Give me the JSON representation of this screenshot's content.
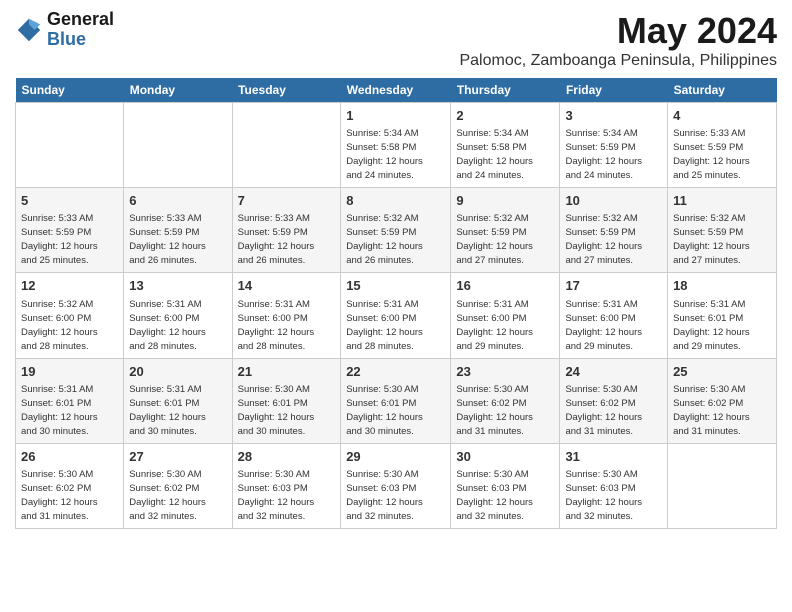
{
  "logo": {
    "general": "General",
    "blue": "Blue"
  },
  "title": {
    "month": "May 2024",
    "location": "Palomoc, Zamboanga Peninsula, Philippines"
  },
  "weekdays": [
    "Sunday",
    "Monday",
    "Tuesday",
    "Wednesday",
    "Thursday",
    "Friday",
    "Saturday"
  ],
  "weeks": [
    [
      {
        "day": "",
        "info": ""
      },
      {
        "day": "",
        "info": ""
      },
      {
        "day": "",
        "info": ""
      },
      {
        "day": "1",
        "info": "Sunrise: 5:34 AM\nSunset: 5:58 PM\nDaylight: 12 hours\nand 24 minutes."
      },
      {
        "day": "2",
        "info": "Sunrise: 5:34 AM\nSunset: 5:58 PM\nDaylight: 12 hours\nand 24 minutes."
      },
      {
        "day": "3",
        "info": "Sunrise: 5:34 AM\nSunset: 5:59 PM\nDaylight: 12 hours\nand 24 minutes."
      },
      {
        "day": "4",
        "info": "Sunrise: 5:33 AM\nSunset: 5:59 PM\nDaylight: 12 hours\nand 25 minutes."
      }
    ],
    [
      {
        "day": "5",
        "info": "Sunrise: 5:33 AM\nSunset: 5:59 PM\nDaylight: 12 hours\nand 25 minutes."
      },
      {
        "day": "6",
        "info": "Sunrise: 5:33 AM\nSunset: 5:59 PM\nDaylight: 12 hours\nand 26 minutes."
      },
      {
        "day": "7",
        "info": "Sunrise: 5:33 AM\nSunset: 5:59 PM\nDaylight: 12 hours\nand 26 minutes."
      },
      {
        "day": "8",
        "info": "Sunrise: 5:32 AM\nSunset: 5:59 PM\nDaylight: 12 hours\nand 26 minutes."
      },
      {
        "day": "9",
        "info": "Sunrise: 5:32 AM\nSunset: 5:59 PM\nDaylight: 12 hours\nand 27 minutes."
      },
      {
        "day": "10",
        "info": "Sunrise: 5:32 AM\nSunset: 5:59 PM\nDaylight: 12 hours\nand 27 minutes."
      },
      {
        "day": "11",
        "info": "Sunrise: 5:32 AM\nSunset: 5:59 PM\nDaylight: 12 hours\nand 27 minutes."
      }
    ],
    [
      {
        "day": "12",
        "info": "Sunrise: 5:32 AM\nSunset: 6:00 PM\nDaylight: 12 hours\nand 28 minutes."
      },
      {
        "day": "13",
        "info": "Sunrise: 5:31 AM\nSunset: 6:00 PM\nDaylight: 12 hours\nand 28 minutes."
      },
      {
        "day": "14",
        "info": "Sunrise: 5:31 AM\nSunset: 6:00 PM\nDaylight: 12 hours\nand 28 minutes."
      },
      {
        "day": "15",
        "info": "Sunrise: 5:31 AM\nSunset: 6:00 PM\nDaylight: 12 hours\nand 28 minutes."
      },
      {
        "day": "16",
        "info": "Sunrise: 5:31 AM\nSunset: 6:00 PM\nDaylight: 12 hours\nand 29 minutes."
      },
      {
        "day": "17",
        "info": "Sunrise: 5:31 AM\nSunset: 6:00 PM\nDaylight: 12 hours\nand 29 minutes."
      },
      {
        "day": "18",
        "info": "Sunrise: 5:31 AM\nSunset: 6:01 PM\nDaylight: 12 hours\nand 29 minutes."
      }
    ],
    [
      {
        "day": "19",
        "info": "Sunrise: 5:31 AM\nSunset: 6:01 PM\nDaylight: 12 hours\nand 30 minutes."
      },
      {
        "day": "20",
        "info": "Sunrise: 5:31 AM\nSunset: 6:01 PM\nDaylight: 12 hours\nand 30 minutes."
      },
      {
        "day": "21",
        "info": "Sunrise: 5:30 AM\nSunset: 6:01 PM\nDaylight: 12 hours\nand 30 minutes."
      },
      {
        "day": "22",
        "info": "Sunrise: 5:30 AM\nSunset: 6:01 PM\nDaylight: 12 hours\nand 30 minutes."
      },
      {
        "day": "23",
        "info": "Sunrise: 5:30 AM\nSunset: 6:02 PM\nDaylight: 12 hours\nand 31 minutes."
      },
      {
        "day": "24",
        "info": "Sunrise: 5:30 AM\nSunset: 6:02 PM\nDaylight: 12 hours\nand 31 minutes."
      },
      {
        "day": "25",
        "info": "Sunrise: 5:30 AM\nSunset: 6:02 PM\nDaylight: 12 hours\nand 31 minutes."
      }
    ],
    [
      {
        "day": "26",
        "info": "Sunrise: 5:30 AM\nSunset: 6:02 PM\nDaylight: 12 hours\nand 31 minutes."
      },
      {
        "day": "27",
        "info": "Sunrise: 5:30 AM\nSunset: 6:02 PM\nDaylight: 12 hours\nand 32 minutes."
      },
      {
        "day": "28",
        "info": "Sunrise: 5:30 AM\nSunset: 6:03 PM\nDaylight: 12 hours\nand 32 minutes."
      },
      {
        "day": "29",
        "info": "Sunrise: 5:30 AM\nSunset: 6:03 PM\nDaylight: 12 hours\nand 32 minutes."
      },
      {
        "day": "30",
        "info": "Sunrise: 5:30 AM\nSunset: 6:03 PM\nDaylight: 12 hours\nand 32 minutes."
      },
      {
        "day": "31",
        "info": "Sunrise: 5:30 AM\nSunset: 6:03 PM\nDaylight: 12 hours\nand 32 minutes."
      },
      {
        "day": "",
        "info": ""
      }
    ]
  ]
}
